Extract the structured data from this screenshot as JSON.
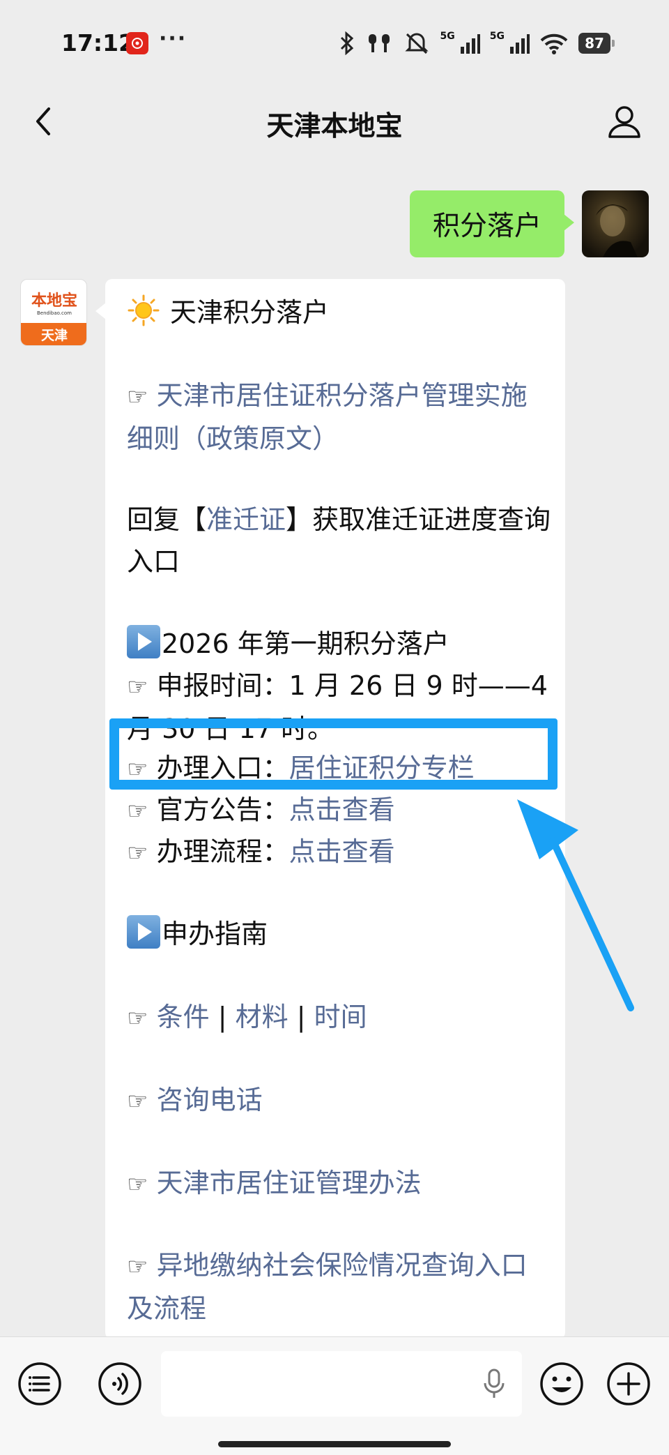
{
  "status_bar": {
    "time": "17:12",
    "dots": "···",
    "battery": "87",
    "network_1": "5G",
    "network_2": "5G"
  },
  "header": {
    "title": "天津本地宝"
  },
  "outgoing_message": {
    "text": "积分落户"
  },
  "bot_avatar": {
    "logo_text": "本地宝",
    "url_text": "Bendibao.com",
    "city_text": "天津"
  },
  "incoming_message": {
    "heading": "天津积分落户",
    "hand_glyph": "☞",
    "policy_link": "天津市居住证积分落户管理实施细则（政策原文）",
    "reply_prefix": "回复【",
    "reply_keyword": "准迁证",
    "reply_suffix": "】获取准迁证进度查询入口",
    "period_title": "2026 年第一期积分落户",
    "apply_time_label": "申报时间：",
    "apply_time_value": "1 月 26 日 9 时——4 月 30 日 17 时。",
    "entry_label": "办理入口：",
    "entry_link": "居住证积分专栏",
    "notice_label": "官方公告：",
    "notice_link": "点击查看",
    "process_label": "办理流程：",
    "process_link": "点击查看",
    "guide_title": "申办指南",
    "guide_links": [
      "条件",
      "材料",
      "时间"
    ],
    "separator": "|",
    "consult_link": "咨询电话",
    "residence_link": "天津市居住证管理办法",
    "insurance_link": "异地缴纳社会保险情况查询入口及流程"
  },
  "annotation": {
    "highlight_color": "#1aa1f5"
  },
  "colors": {
    "link": "#576b95",
    "out_bubble": "#95ec69",
    "background": "#ededed"
  }
}
